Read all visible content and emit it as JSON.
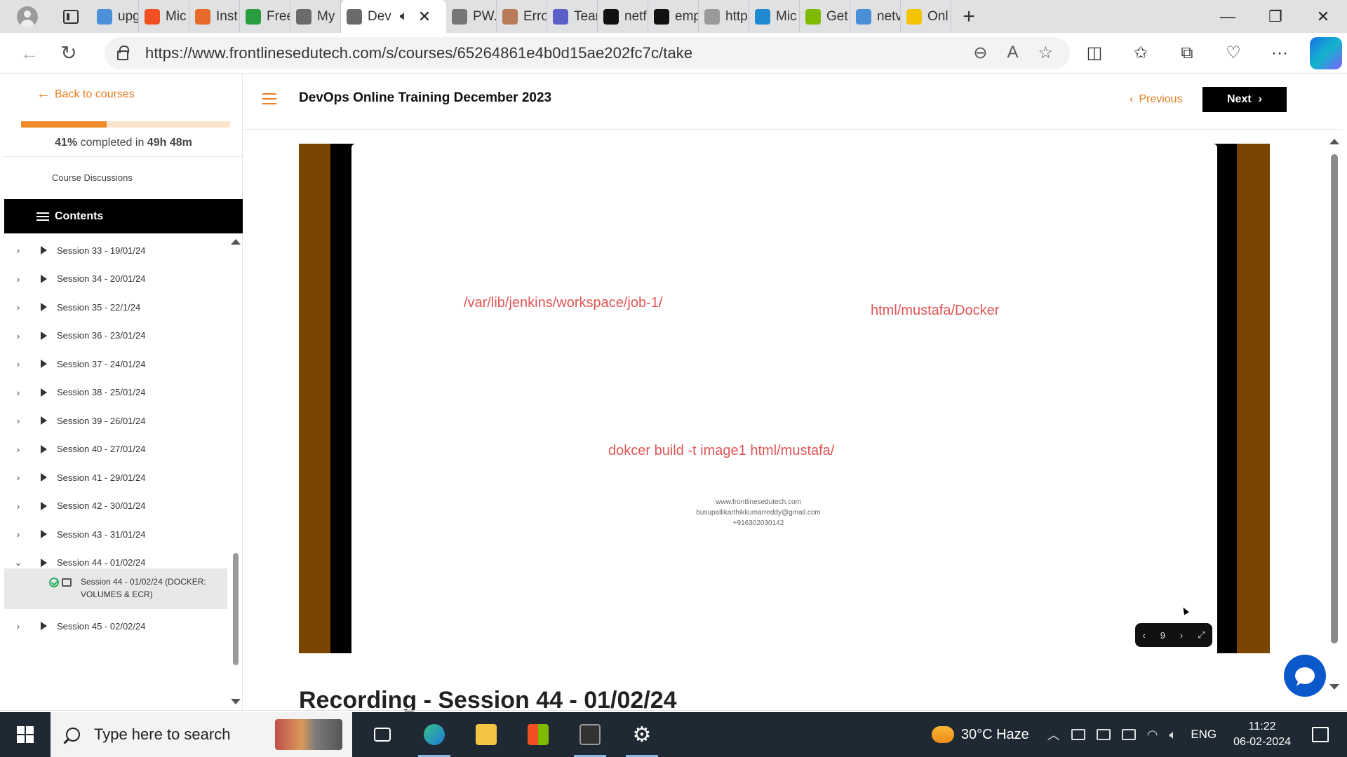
{
  "browser": {
    "tabs": [
      {
        "label": "upg",
        "icon": "search-icon",
        "color": "#4a90d9"
      },
      {
        "label": "Mic",
        "icon": "microsoft-icon",
        "color": "#f25022"
      },
      {
        "label": "Inst",
        "icon": "office-icon",
        "color": "#e86a2b"
      },
      {
        "label": "Free",
        "icon": "sheet-icon",
        "color": "#2a9d3e"
      },
      {
        "label": "My",
        "icon": "app-icon",
        "color": "#6b6b6b"
      },
      {
        "label": "Dev",
        "icon": "app-icon",
        "color": "#6b6b6b",
        "active": true
      },
      {
        "label": "PW.",
        "icon": "document-icon",
        "color": "#777777"
      },
      {
        "label": "Erro",
        "icon": "avatar-icon",
        "color": "#b97a57"
      },
      {
        "label": "Tear",
        "icon": "teams-icon",
        "color": "#5b5fc7"
      },
      {
        "label": "netf",
        "icon": "github-icon",
        "color": "#111111"
      },
      {
        "label": "emp",
        "icon": "github-icon",
        "color": "#111111"
      },
      {
        "label": "http",
        "icon": "globe-icon",
        "color": "#9a9a9a"
      },
      {
        "label": "Mic",
        "icon": "edge-icon",
        "color": "#1f8ad2"
      },
      {
        "label": "Get",
        "icon": "microsoft-icon",
        "color": "#7fba00"
      },
      {
        "label": "netv",
        "icon": "search-icon",
        "color": "#4a90d9"
      },
      {
        "label": "Onl",
        "icon": "app-icon",
        "color": "#f5c400"
      }
    ],
    "url": "https://www.frontlinesedutech.com/s/courses/65264861e4b0d15ae202fc7c/take"
  },
  "sidebar": {
    "back_label": "Back to courses",
    "progress_percent": 41,
    "progress_label": "41%",
    "progress_mid": " completed in ",
    "progress_time": "49h 48m",
    "discussions_label": "Course Discussions",
    "contents_label": "Contents",
    "sessions": [
      {
        "label": "Session 33 - 19/01/24",
        "expanded": false
      },
      {
        "label": "Session 34 - 20/01/24",
        "expanded": false
      },
      {
        "label": "Session 35 - 22/1/24",
        "expanded": false
      },
      {
        "label": "Session 36 - 23/01/24",
        "expanded": false
      },
      {
        "label": "Session 37 - 24/01/24",
        "expanded": false
      },
      {
        "label": "Session 38 - 25/01/24",
        "expanded": false
      },
      {
        "label": "Session 39 - 26/01/24",
        "expanded": false
      },
      {
        "label": "Session 40 - 27/01/24",
        "expanded": false
      },
      {
        "label": "Session 41 - 29/01/24",
        "expanded": false
      },
      {
        "label": "Session 42 - 30/01/24",
        "expanded": false
      },
      {
        "label": "Session 43 - 31/01/24",
        "expanded": false
      },
      {
        "label": "Session 44 - 01/02/24",
        "expanded": true
      },
      {
        "label": "Session 45 - 02/02/24",
        "expanded": false
      }
    ],
    "sub_item": "Session 44 - 01/02/24 (DOCKER: VOLUMES & ECR)"
  },
  "main": {
    "course_title": "DevOps Online Training December 2023",
    "prev_label": "Previous",
    "next_label": "Next",
    "slide": {
      "text1": "/var/lib/jenkins/workspace/job-1/",
      "text2": "html/mustafa/Docker",
      "text3": "dokcer build -t image1 html/mustafa/",
      "footer": [
        "www.frontlinesedutech.com",
        "busupallikarthikkumarreddy@gmail.com",
        "+916302030142"
      ],
      "page_number": "9"
    },
    "next_heading": "Recording - Session 44 - 01/02/24"
  },
  "taskbar": {
    "search_placeholder": "Type here to search",
    "weather": "30°C  Haze",
    "lang": "ENG",
    "time": "11:22",
    "date": "06-02-2024"
  },
  "colors": {
    "accent": "#e67e22",
    "slide_text": "#e05555",
    "player_frame": "#7a4500"
  }
}
